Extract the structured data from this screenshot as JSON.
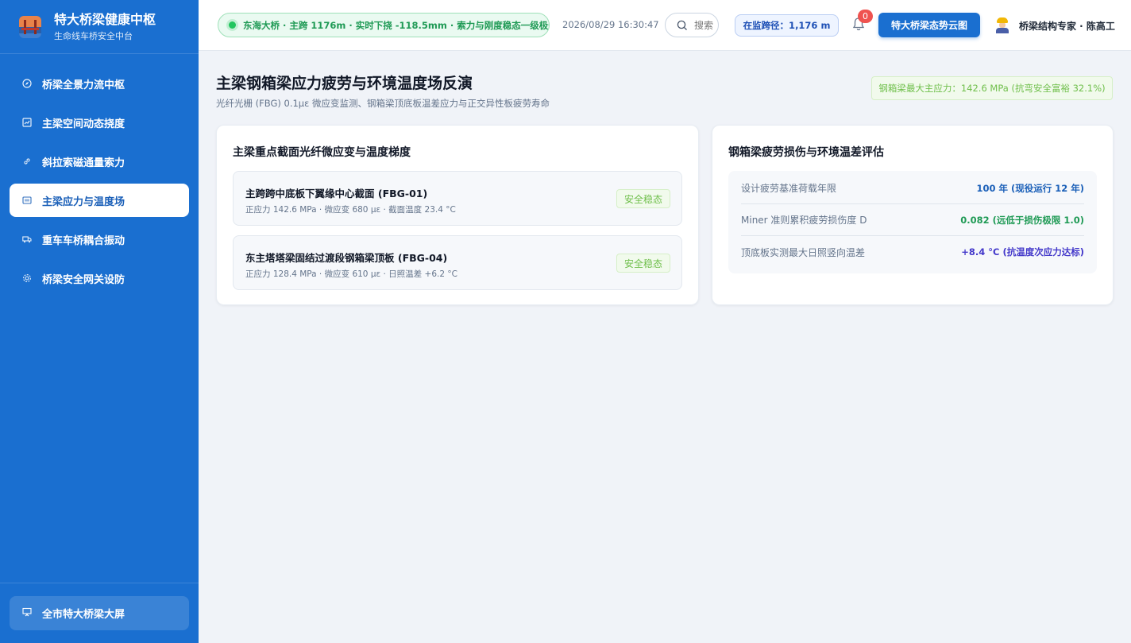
{
  "brand": {
    "title": "特大桥梁健康中枢",
    "subtitle": "生命线车桥安全中台"
  },
  "sidebar": {
    "items": [
      {
        "label": "桥梁全景力流中枢",
        "icon": "compass-icon",
        "active": false
      },
      {
        "label": "主梁空间动态挠度",
        "icon": "line-chart-icon",
        "active": false
      },
      {
        "label": "斜拉索磁通量索力",
        "icon": "link-icon",
        "active": false
      },
      {
        "label": "主梁应力与温度场",
        "icon": "gauge-bars-icon",
        "active": true
      },
      {
        "label": "重车车桥耦合振动",
        "icon": "truck-icon",
        "active": false
      },
      {
        "label": "桥梁安全网关设防",
        "icon": "gear-icon",
        "active": false
      }
    ],
    "bottom_label": "全市特大桥梁大屏",
    "bottom_icon": "presentation-screen-icon"
  },
  "header": {
    "status_text": "东海大桥 · 主跨 1176m · 实时下挠 -118.5mm · 索力与刚度稳态一级极优",
    "datetime": "2026/08/29 16:30:47",
    "search_placeholder": "搜索",
    "span_badge": "在监跨径：1,176 m",
    "notification_count": "0",
    "cta_label": "特大桥梁态势云图",
    "user_name": "桥梁结构专家 · 陈高工"
  },
  "page": {
    "title": "主梁钢箱梁应力疲劳与环境温度场反演",
    "subtitle": "光纤光栅 (FBG) 0.1με 微应变监测、钢箱梁顶底板温差应力与正交异性板疲劳寿命",
    "alert": "钢箱梁最大主应力：142.6 MPa (抗弯安全富裕 32.1%)"
  },
  "sensors_card": {
    "title": "主梁重点截面光纤微应变与温度梯度",
    "sensors": [
      {
        "name": "主跨跨中底板下翼缘中心截面 (FBG-01)",
        "meta": "正应力 142.6 MPa · 微应变 680 με · 截面温度 23.4 °C",
        "status": "安全稳态"
      },
      {
        "name": "东主塔塔梁固结过渡段钢箱梁顶板 (FBG-04)",
        "meta": "正应力 128.4 MPa · 微应变 610 με · 日照温差 +6.2 °C",
        "status": "安全稳态"
      }
    ]
  },
  "fatigue_card": {
    "title": "钢箱梁疲劳损伤与环境温差评估",
    "rows": [
      {
        "label": "设计疲劳基准荷载年限",
        "value": "100 年 (现役运行 12 年)",
        "color": "#1a5fb8"
      },
      {
        "label": "Miner 准则累积疲劳损伤度 D",
        "value": "0.082 (远低于损伤极限 1.0)",
        "color": "#1f9a55"
      },
      {
        "label": "顶底板实测最大日照竖向温差",
        "value": "+8.4 °C (抗温度次应力达标)",
        "color": "#4338ca"
      }
    ]
  },
  "colors": {
    "sidebar": "#1a6fd0",
    "accent": "#1a6fd0",
    "success": "#1f9a55",
    "safe_tag": "#6fbf4b",
    "danger_badge": "#ef5350"
  }
}
